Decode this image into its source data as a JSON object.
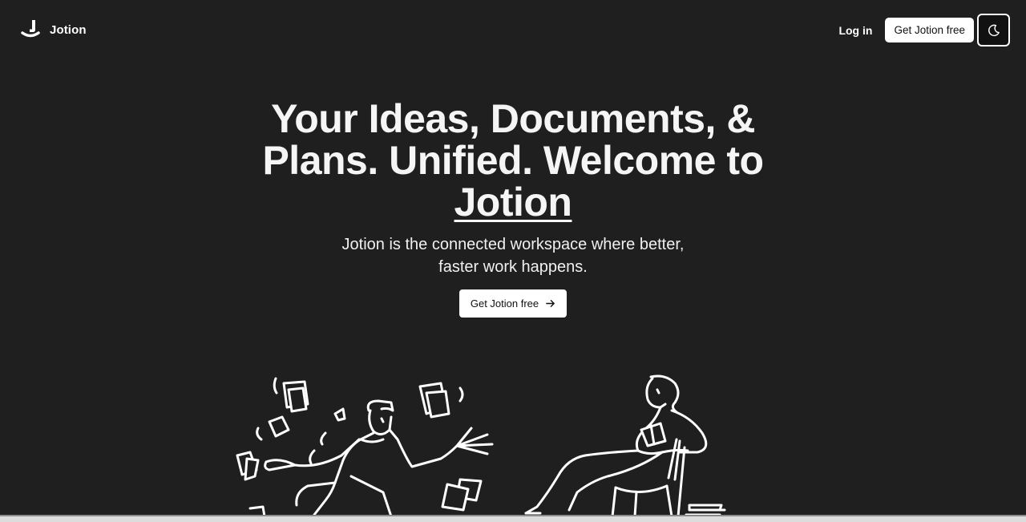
{
  "navbar": {
    "brand_name": "Jotion",
    "login_label": "Log in",
    "cta_label": "Get Jotion free",
    "theme_icon": "moon-icon"
  },
  "hero": {
    "title_prefix": "Your Ideas, Documents, & Plans. Unified. Welcome to ",
    "title_brand": "Jotion",
    "subtitle": "Jotion is the connected workspace where better, faster work happens.",
    "cta_label": "Get Jotion free",
    "cta_icon": "arrow-right-icon"
  },
  "colors": {
    "background": "#1f1f1f",
    "text": "#ffffff",
    "button_bg": "#ffffff",
    "button_text": "#111111"
  }
}
